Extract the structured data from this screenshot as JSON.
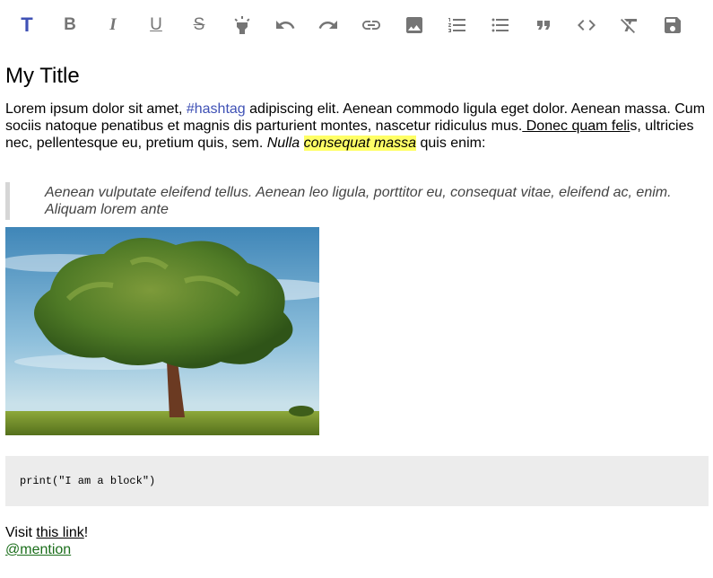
{
  "toolbar": {
    "buttons": [
      {
        "icon": "title-icon",
        "glyph": "T",
        "active": true
      },
      {
        "icon": "bold-icon",
        "glyph": "B"
      },
      {
        "icon": "italic-icon",
        "glyph": "I"
      },
      {
        "icon": "underline-icon",
        "glyph": "U"
      },
      {
        "icon": "strikethrough-icon",
        "glyph": "S"
      },
      {
        "icon": "highlight-icon"
      },
      {
        "icon": "undo-icon"
      },
      {
        "icon": "redo-icon"
      },
      {
        "icon": "link-icon"
      },
      {
        "icon": "image-icon"
      },
      {
        "icon": "numbered-list-icon"
      },
      {
        "icon": "bulleted-list-icon"
      },
      {
        "icon": "quote-icon"
      },
      {
        "icon": "code-icon"
      },
      {
        "icon": "clear-format-icon"
      },
      {
        "icon": "save-icon"
      }
    ],
    "active_color": "#3f51b5",
    "icon_color": "#757575"
  },
  "content": {
    "title": "My Title",
    "paragraph": {
      "part1": "Lorem ipsum dolor sit amet, ",
      "hashtag": "#hashtag",
      "part2": " adipiscing elit. Aenean commodo ligula eget dolor. Aenean massa. Cum sociis natoque penatibus et magnis dis parturient montes, nascetur ridiculus mus.",
      "underlined": " Donec quam feli",
      "part3": "s, ultricies nec, pellentesque eu, pretium quis, sem. ",
      "italic": "Nulla ",
      "highlighted": "consequat massa",
      "part4": " quis enim:"
    },
    "quote": "Aenean vulputate eleifend tellus. Aenean leo ligula, porttitor eu, consequat vitae, eleifend ac, enim. Aliquam lorem ante",
    "code": "print(\"I am a block\")",
    "visit_prefix": "Visit ",
    "link_text": "this link",
    "visit_suffix": "!",
    "mention": "@mention",
    "colors": {
      "hashtag": "#3f51b5",
      "highlight": "#ffff66",
      "mention": "#1b6e1b",
      "code_bg": "#ececec"
    }
  }
}
